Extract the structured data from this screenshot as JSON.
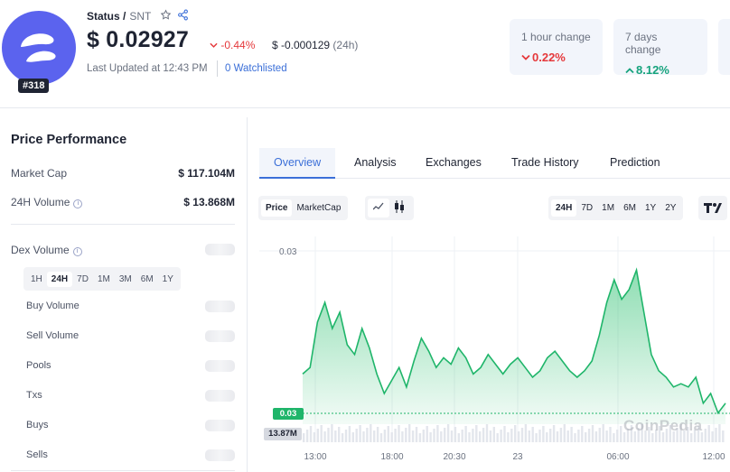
{
  "header": {
    "name": "Status /",
    "symbol": "SNT",
    "rank": "#318",
    "price": "$ 0.02927",
    "price_change_pct": "-0.44%",
    "price_change_abs": "$ -0.000129",
    "price_change_period": "(24h)",
    "last_updated": "Last Updated at 12:43 PM",
    "watchlisted": "0 Watchlisted",
    "colors": {
      "brand": "#5b63ee",
      "negative": "#e5383b",
      "positive": "#16a37d",
      "link": "#3b6fd8"
    }
  },
  "stats_cards": [
    {
      "label": "1 hour change",
      "value": "0.22%",
      "direction": "down"
    },
    {
      "label": "7 days change",
      "value": "8.12%",
      "direction": "up"
    }
  ],
  "performance": {
    "title": "Price Performance",
    "market_cap_label": "Market Cap",
    "market_cap_value": "$ 117.104M",
    "volume_label": "24H Volume",
    "volume_value": "$ 13.868M",
    "dex_volume_label": "Dex Volume",
    "dex_ranges": [
      "1H",
      "24H",
      "7D",
      "1M",
      "3M",
      "6M",
      "1Y"
    ],
    "dex_selected": "24H",
    "rows": [
      "Buy Volume",
      "Sell Volume",
      "Pools",
      "Txs",
      "Buys",
      "Sells"
    ]
  },
  "tabs": [
    "Overview",
    "Analysis",
    "Exchanges",
    "Trade History",
    "Prediction"
  ],
  "active_tab": "Overview",
  "chart_controls": {
    "type_toggle": [
      "Price",
      "MarketCap"
    ],
    "type_selected": "Price",
    "style_icons": [
      "line-chart-icon",
      "candlestick-icon"
    ],
    "ranges": [
      "24H",
      "7D",
      "1M",
      "6M",
      "1Y",
      "2Y"
    ],
    "range_selected": "24H"
  },
  "chart_data": {
    "type": "area",
    "x_ticks": [
      "13:00",
      "18:00",
      "20:30",
      "23",
      "06:00",
      "12:00"
    ],
    "y_tick": "0.03",
    "current_price_tag": "0.03",
    "volume_tag": "13.87M",
    "watermark": "CoinPedia",
    "color": "#1fb56a",
    "series": [
      {
        "values": [
          0.02936,
          0.02938,
          0.02952,
          0.02958,
          0.0295,
          0.02955,
          0.02945,
          0.02942,
          0.0295,
          0.02944,
          0.02936,
          0.0293,
          0.02934,
          0.02938,
          0.02932,
          0.0294,
          0.02947,
          0.02943,
          0.02938,
          0.02941,
          0.02939,
          0.02944,
          0.02941,
          0.02936,
          0.02938,
          0.02942,
          0.02939,
          0.02936,
          0.02939,
          0.02941,
          0.02938,
          0.02935,
          0.02937,
          0.02941,
          0.02943,
          0.0294,
          0.02937,
          0.02935,
          0.02937,
          0.0294,
          0.02948,
          0.02958,
          0.02965,
          0.02959,
          0.02962,
          0.02968,
          0.02955,
          0.02942,
          0.02937,
          0.02935,
          0.02932,
          0.02933,
          0.02932,
          0.02935,
          0.02927,
          0.0293,
          0.02924,
          0.02927
        ]
      }
    ]
  }
}
